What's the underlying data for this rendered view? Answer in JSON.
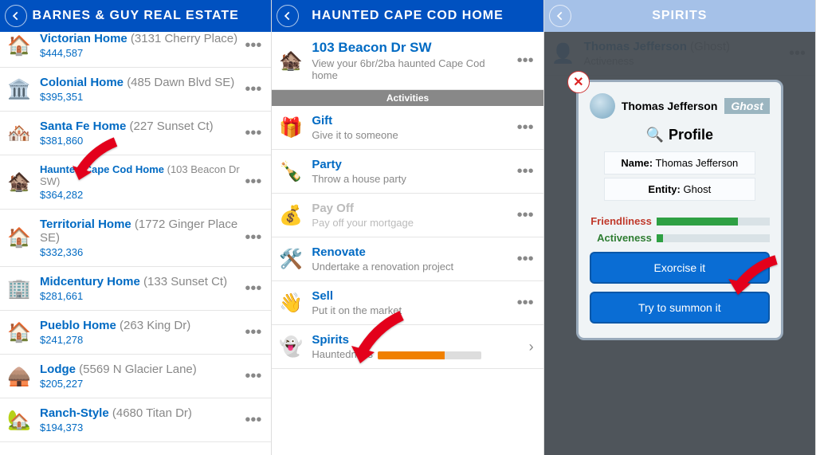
{
  "panel1": {
    "title": "Barnes & Guy Real Estate",
    "listings": [
      {
        "name": "Victorian Home",
        "addr": "(3131 Cherry Place)",
        "price": "$444,587",
        "icon": "🏠"
      },
      {
        "name": "Colonial Home",
        "addr": "(485 Dawn Blvd SE)",
        "price": "$395,351",
        "icon": "🏛️"
      },
      {
        "name": "Santa Fe Home",
        "addr": "(227 Sunset Ct)",
        "price": "$381,860",
        "icon": "🏘️"
      },
      {
        "name": "Haunted Cape Cod Home",
        "addr": "(103 Beacon Dr SW)",
        "price": "$364,282",
        "icon": "🏚️",
        "highlighted": true
      },
      {
        "name": "Territorial Home",
        "addr": "(1772 Ginger Place SE)",
        "price": "$332,336",
        "icon": "🏠"
      },
      {
        "name": "Midcentury Home",
        "addr": "(133 Sunset Ct)",
        "price": "$281,661",
        "icon": "🏢"
      },
      {
        "name": "Pueblo Home",
        "addr": "(263 King Dr)",
        "price": "$241,278",
        "icon": "🏠"
      },
      {
        "name": "Lodge",
        "addr": "(5569 N Glacier Lane)",
        "price": "$205,227",
        "icon": "🛖"
      },
      {
        "name": "Ranch-Style",
        "addr": "(4680 Titan Dr)",
        "price": "$194,373",
        "icon": "🏡"
      }
    ]
  },
  "panel2": {
    "title": "Haunted Cape Cod Home",
    "property": {
      "address": "103 Beacon Dr SW",
      "desc": "View your 6br/2ba haunted Cape Cod home",
      "icon": "🏚️"
    },
    "activities_label": "Activities",
    "activities": [
      {
        "name": "Gift",
        "desc": "Give it to someone",
        "icon": "🎁"
      },
      {
        "name": "Party",
        "desc": "Throw a house party",
        "icon": "🍾"
      },
      {
        "name": "Pay Off",
        "desc": "Pay off your mortgage",
        "icon": "💰",
        "disabled": true
      },
      {
        "name": "Renovate",
        "desc": "Undertake a renovation project",
        "icon": "🛠️"
      },
      {
        "name": "Sell",
        "desc": "Put it on the market",
        "icon": "👋"
      },
      {
        "name": "Spirits",
        "desc_label": "Hauntedness",
        "icon": "👻",
        "bar_pct": 65,
        "chevron": true,
        "highlighted": true
      }
    ]
  },
  "panel3": {
    "title": "Spirits",
    "ghost_row": {
      "name": "Thomas Jefferson",
      "type": "(Ghost)",
      "sub": "Activeness"
    },
    "modal": {
      "name": "Thomas Jefferson",
      "tag": "Ghost",
      "section": "Profile",
      "name_label": "Name:",
      "name_value": "Thomas Jefferson",
      "entity_label": "Entity:",
      "entity_value": "Ghost",
      "friendliness_label": "Friendliness",
      "friendliness_pct": 72,
      "activeness_label": "Activeness",
      "activeness_pct": 6,
      "btn_exorcise": "Exorcise it",
      "btn_summon": "Try to summon it"
    }
  }
}
